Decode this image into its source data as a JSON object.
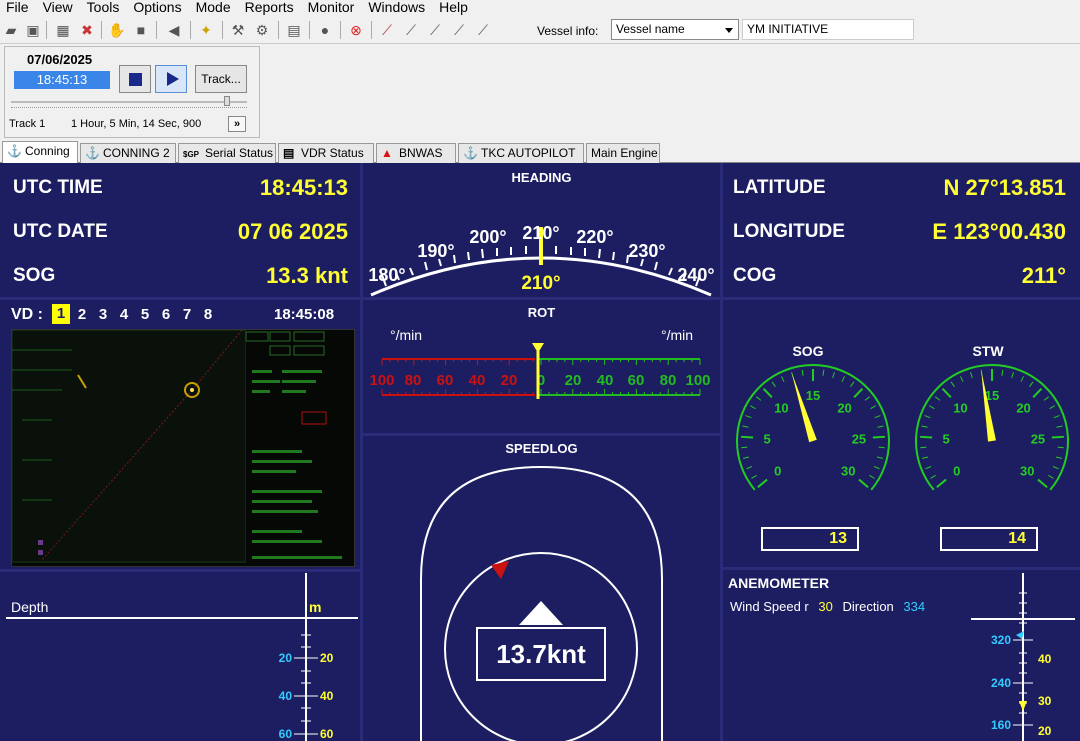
{
  "menu": [
    "File",
    "View",
    "Tools",
    "Options",
    "Mode",
    "Reports",
    "Monitor",
    "Windows",
    "Help"
  ],
  "toolbar": {
    "vessel_info_label": "Vessel info:",
    "vessel_select": "Vessel name",
    "vessel_value": "YM INITIATIVE"
  },
  "playback": {
    "date": "07/06/2025",
    "time": "18:45:13",
    "track_button": "Track...",
    "track_label": "Track 1",
    "track_info": "1 Hour, 5 Min, 14 Sec, 900",
    "next_button": "»"
  },
  "tabs": [
    {
      "label": "Conning",
      "icon": "⚓",
      "active": true
    },
    {
      "label": "CONNING 2",
      "icon": "⚓",
      "active": false
    },
    {
      "label": "Serial Status",
      "icon": "$GP",
      "active": false
    },
    {
      "label": "VDR Status",
      "icon": "▤",
      "active": false
    },
    {
      "label": "BNWAS",
      "icon": "▲",
      "active": false
    },
    {
      "label": "TKC AUTOPILOT",
      "icon": "⚓",
      "active": false
    },
    {
      "label": "Main Engine",
      "icon": "",
      "active": false
    }
  ],
  "conning": {
    "utc_time_label": "UTC TIME",
    "utc_time": "18:45:13",
    "utc_date_label": "UTC DATE",
    "utc_date": "07 06 2025",
    "sog_label": "SOG",
    "sog": "13.3 knt",
    "heading_title": "HEADING",
    "heading_value": "210°",
    "heading_scale": [
      "180°",
      "190°",
      "200°",
      "210°",
      "220°",
      "230°",
      "240°"
    ],
    "latitude_label": "LATITUDE",
    "latitude": "N 27°13.851",
    "longitude_label": "LONGITUDE",
    "longitude": "E 123°00.430",
    "cog_label": "COG",
    "cog": "211°",
    "vd_label": "VD :",
    "vd_numbers": [
      "1",
      "2",
      "3",
      "4",
      "5",
      "6",
      "7",
      "8"
    ],
    "vd_selected": "1",
    "vd_time": "18:45:08",
    "rot_title": "ROT",
    "rot_unit_left": "°/min",
    "rot_unit_right": "°/min",
    "rot_left_scale": [
      "100",
      "80",
      "60",
      "40",
      "20"
    ],
    "rot_right_scale": [
      "0",
      "20",
      "40",
      "60",
      "80",
      "100"
    ],
    "rot_value": 0,
    "speedlog_title": "SPEEDLOG",
    "speedlog_value": "13.7knt",
    "sog_gauge_title": "SOG",
    "stw_gauge_title": "STW",
    "gauge_scale": [
      "0",
      "5",
      "10",
      "15",
      "20",
      "25",
      "30"
    ],
    "sog_gauge_value": "13",
    "stw_gauge_value": "14",
    "anemometer_title": "ANEMOMETER",
    "wind_speed_label": "Wind Speed r",
    "wind_speed": "30",
    "direction_label": "Direction",
    "direction": "334",
    "depth_title": "Depth",
    "depth_unit": "m",
    "depth_scale": [
      "20",
      "40",
      "60"
    ],
    "anem_dir_scale": [
      "320",
      "240",
      "160"
    ],
    "anem_speed_scale": [
      "40",
      "30",
      "20"
    ]
  },
  "colors": {
    "panel_bg": "#1d1e61",
    "value_yellow": "#ffff33",
    "gauge_green": "#22cc22",
    "rot_red": "#cc1111",
    "cyan": "#33ccff"
  }
}
